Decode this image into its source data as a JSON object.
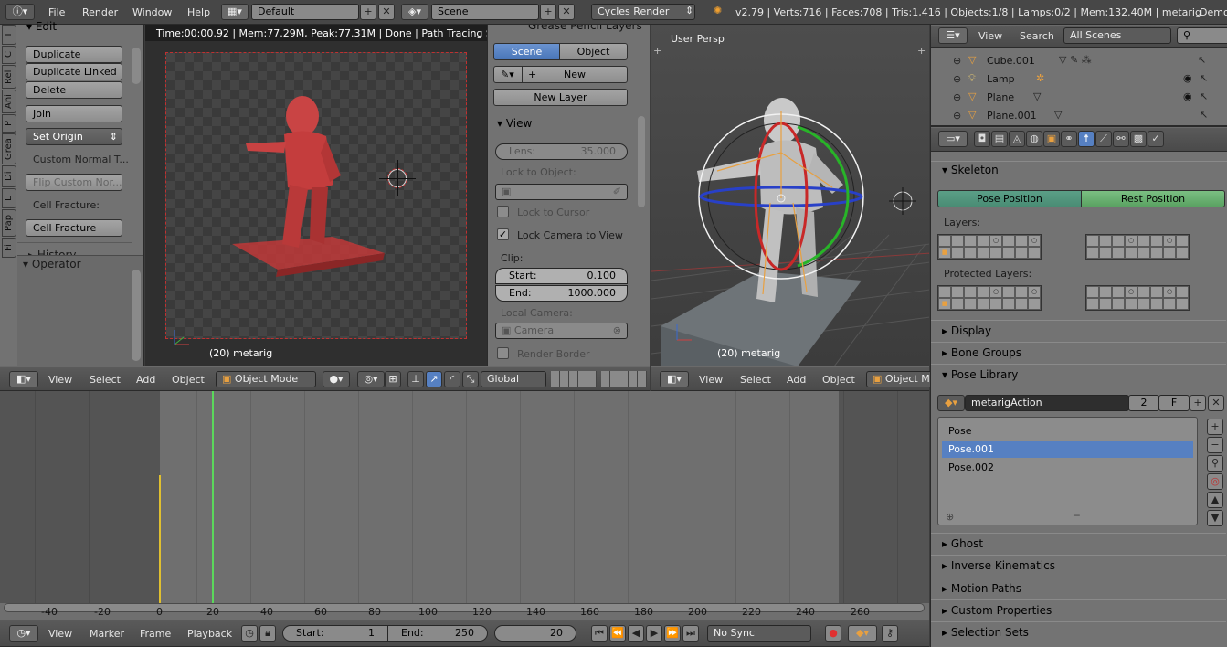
{
  "topbar": {
    "menu": [
      "File",
      "Render",
      "Window",
      "Help"
    ],
    "layout_name": "Default",
    "scene_name": "Scene",
    "render_engine": "Cycles Render",
    "stats": "v2.79 | Verts:716 | Faces:708 | Tris:1,416 | Objects:1/8 | Lamps:0/2 | Mem:132.40M | metarig",
    "demo_label": "Demo"
  },
  "toolshelf": {
    "tabs": [
      "T",
      "C",
      "Rel",
      "Ani",
      "P",
      "Grea",
      "Di",
      "L",
      "Pap",
      "Fi"
    ],
    "edit_header": "Edit",
    "buttons": {
      "duplicate": "Duplicate",
      "duplicate_linked": "Duplicate Linked",
      "delete": "Delete",
      "join": "Join",
      "set_origin": "Set Origin",
      "custom_normal": "Custom Normal T...",
      "flip_custom": "Flip Custom Nor...",
      "cell_fracture_label": "Cell Fracture:",
      "cell_fracture": "Cell Fracture"
    },
    "history": "History",
    "operator": "Operator"
  },
  "render_view": {
    "status": "Time:00:00.92 | Mem:77.29M, Peak:77.31M | Done | Path Tracing Samp",
    "object_label": "(20) metarig"
  },
  "properties_n": {
    "grease_header": "Grease Pencil Layers",
    "scene_tab": "Scene",
    "object_tab": "Object",
    "new_button": "New",
    "new_layer": "New Layer",
    "view_header": "View",
    "lens_label": "Lens:",
    "lens_value": "35.000",
    "lock_object_label": "Lock to Object:",
    "lock_cursor": "Lock to Cursor",
    "lock_camera": "Lock Camera to View",
    "clip_label": "Clip:",
    "start_label": "Start:",
    "start_value": "0.100",
    "end_label": "End:",
    "end_value": "1000.000",
    "local_camera_label": "Local Camera:",
    "camera_field": "Camera",
    "render_border": "Render Border"
  },
  "viewport3d": {
    "persp_label": "User Persp",
    "object_label": "(20) metarig"
  },
  "view_header_left": {
    "menus": [
      "View",
      "Select",
      "Add",
      "Object"
    ],
    "mode": "Object Mode",
    "orientation": "Global"
  },
  "view_header_right": {
    "menus": [
      "View",
      "Select",
      "Add",
      "Object"
    ],
    "mode": "Object M"
  },
  "outliner": {
    "view": "View",
    "search": "Search",
    "scene_filter": "All Scenes",
    "items": [
      {
        "name": "Cube.001",
        "icon": "triangle-icon"
      },
      {
        "name": "Lamp",
        "icon": "lamp-icon"
      },
      {
        "name": "Plane",
        "icon": "triangle-icon"
      },
      {
        "name": "Plane.001",
        "icon": "triangle-icon"
      }
    ]
  },
  "properties": {
    "skeleton": "Skeleton",
    "pose_position": "Pose Position",
    "rest_position": "Rest Position",
    "layers": "Layers:",
    "protected_layers": "Protected Layers:",
    "display": "Display",
    "bone_groups": "Bone Groups",
    "pose_library": "Pose Library",
    "action_name": "metarigAction",
    "action_users": "2",
    "action_fake": "F",
    "poses": [
      "Pose",
      "Pose.001",
      "Pose.002"
    ],
    "ghost": "Ghost",
    "inverse_kinematics": "Inverse Kinematics",
    "motion_paths": "Motion Paths",
    "custom_properties": "Custom Properties",
    "selection_sets": "Selection Sets"
  },
  "timeline": {
    "ticks": [
      "-40",
      "-20",
      "0",
      "20",
      "40",
      "60",
      "80",
      "100",
      "120",
      "140",
      "160",
      "180",
      "200",
      "220",
      "240",
      "260"
    ],
    "menus": [
      "View",
      "Marker",
      "Frame",
      "Playback"
    ],
    "start_label": "Start:",
    "start_value": "1",
    "end_label": "End:",
    "end_value": "250",
    "current_frame": "20",
    "sync": "No Sync"
  },
  "colors": {
    "accent_blue": "#5680c2",
    "selection_blue": "#5680c2",
    "timeline_cursor": "#5bd85b",
    "pose_green": "#66b06e",
    "render_red": "#d94a4a"
  }
}
